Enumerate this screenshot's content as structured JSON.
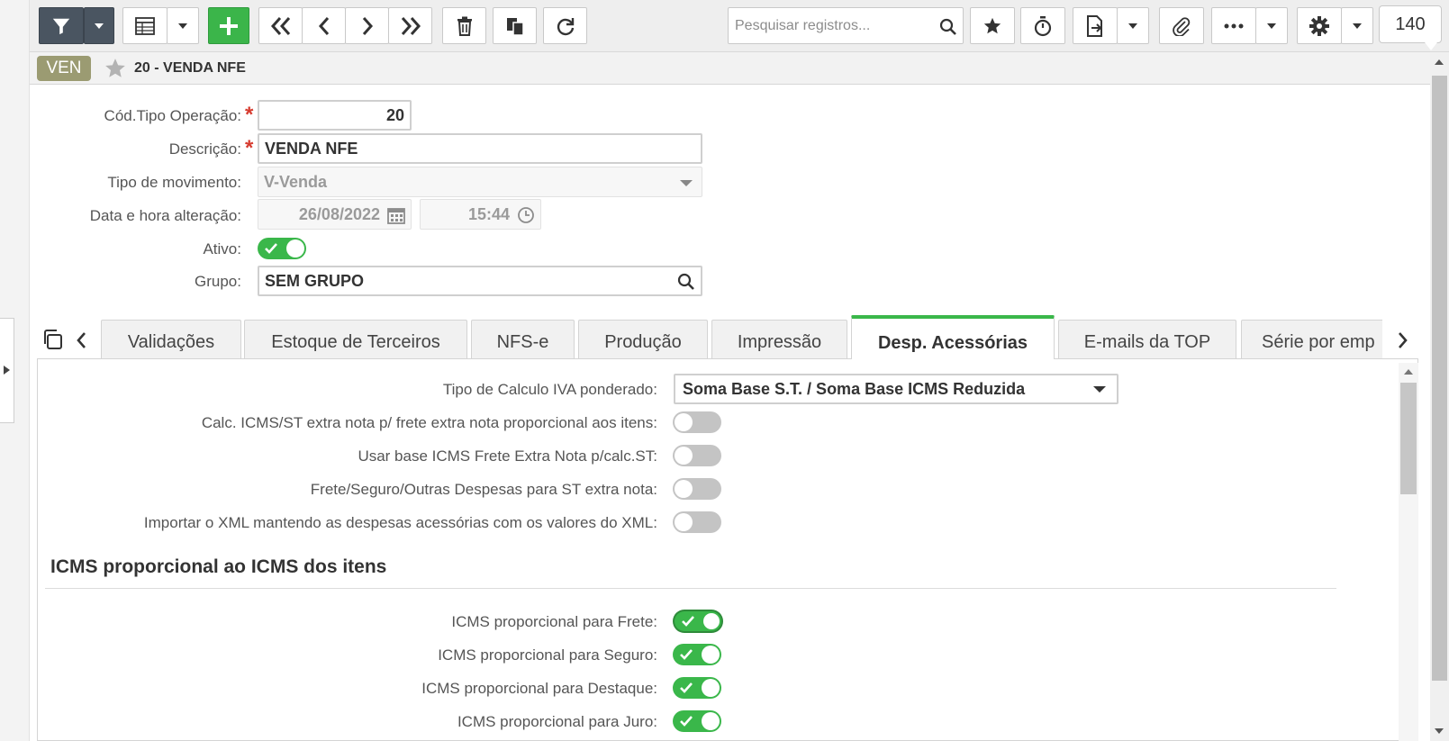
{
  "toolbar": {
    "search_placeholder": "Pesquisar registros...",
    "record_count": "140"
  },
  "header": {
    "module_badge": "VEN",
    "title": "20 - VENDA NFE"
  },
  "form": {
    "cod_tipo_operacao": {
      "label": "Cód.Tipo Operação:",
      "value": "20",
      "required": "*"
    },
    "descricao": {
      "label": "Descrição:",
      "value": "VENDA NFE",
      "required": "*"
    },
    "tipo_movimento": {
      "label": "Tipo de movimento:",
      "value": "V-Venda"
    },
    "data_hora_alteracao": {
      "label": "Data e hora alteração:",
      "date": "26/08/2022",
      "time": "15:44"
    },
    "ativo": {
      "label": "Ativo:",
      "value": true
    },
    "grupo": {
      "label": "Grupo:",
      "value": "SEM GRUPO"
    }
  },
  "tabs": [
    {
      "label": "Validações"
    },
    {
      "label": "Estoque de Terceiros"
    },
    {
      "label": "NFS-e"
    },
    {
      "label": "Produção"
    },
    {
      "label": "Impressão"
    },
    {
      "label": "Desp. Acessórias",
      "active": true
    },
    {
      "label": "E-mails da TOP"
    },
    {
      "label": "Série por emp"
    }
  ],
  "panel": {
    "tipo_calculo_iva": {
      "label": "Tipo de Calculo IVA ponderado:",
      "value": "Soma Base S.T. / Soma Base ICMS Reduzida"
    },
    "toggles": [
      {
        "label": "Calc. ICMS/ST extra nota p/ frete extra nota proporcional aos itens:",
        "value": false
      },
      {
        "label": "Usar base ICMS Frete Extra Nota p/calc.ST:",
        "value": false
      },
      {
        "label": "Frete/Seguro/Outras Despesas para ST extra nota:",
        "value": false
      },
      {
        "label": "Importar o XML mantendo as despesas acessórias com os valores do XML:",
        "value": false
      }
    ],
    "section_title": "ICMS proporcional ao ICMS dos itens",
    "section_toggles": [
      {
        "label": "ICMS proporcional para Frete:",
        "value": true
      },
      {
        "label": "ICMS proporcional para Seguro:",
        "value": true
      },
      {
        "label": "ICMS proporcional para Destaque:",
        "value": true
      },
      {
        "label": "ICMS proporcional para Juro:",
        "value": true
      }
    ]
  },
  "colors": {
    "accent_green": "#3ab74a",
    "toolbar_dark": "#4a5561",
    "module_badge": "#9b9b72",
    "required_red": "#d63b2f"
  }
}
